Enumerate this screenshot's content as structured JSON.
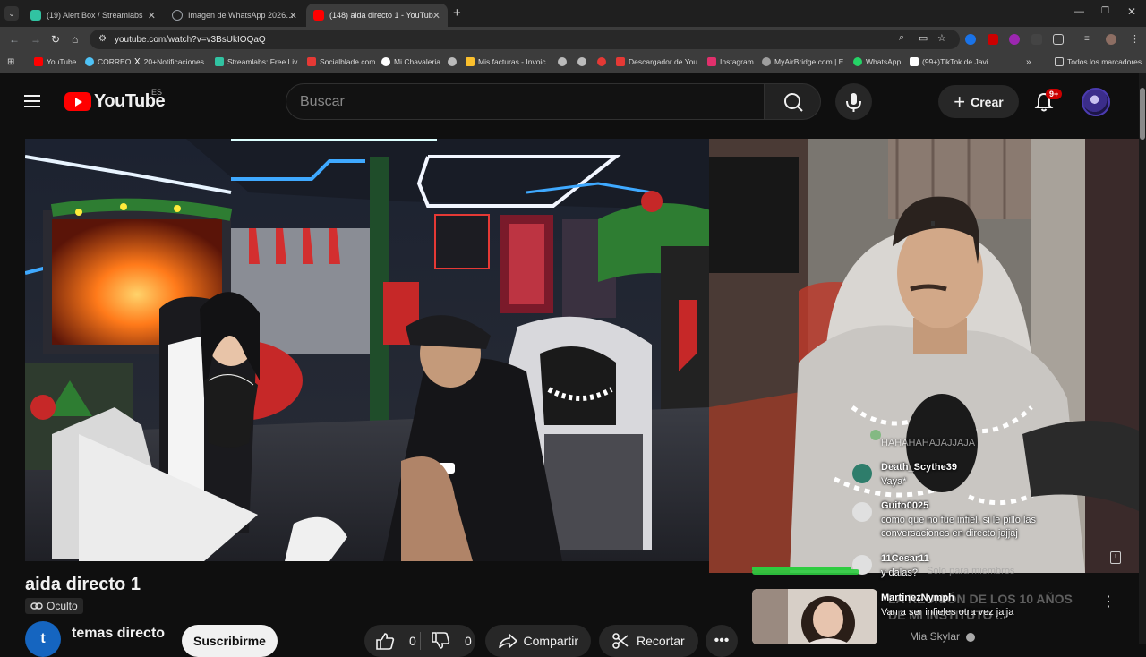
{
  "browser": {
    "tabs": [
      {
        "title": "(19) Alert Box / Streamlabs",
        "icon": "streamlabs-icon",
        "color": "#31c3a2"
      },
      {
        "title": "Imagen de WhatsApp 2026-01-",
        "icon": "globe-icon",
        "color": "#9aa0a6"
      },
      {
        "title": "(148) aida directo 1 - YouTub",
        "icon": "youtube-icon",
        "color": "#ff0000",
        "active": true
      }
    ],
    "url": "youtube.com/watch?v=v3BsUkIOQaQ",
    "bookmarks": [
      {
        "label": "YouTube",
        "color": "#ff0000"
      },
      {
        "label": "CORREO",
        "color": "#4fc3f7"
      },
      {
        "label": "20+Notificaciones",
        "color": "#ffffff"
      },
      {
        "label": "Streamlabs: Free Liv...",
        "color": "#31c3a2"
      },
      {
        "label": "Socialblade.com",
        "color": "#e53935"
      },
      {
        "label": "Mi Chavaleria",
        "color": "#ffffff"
      },
      {
        "label": "",
        "color": "#bbbbbb"
      },
      {
        "label": "Mis facturas - Invoic...",
        "color": "#fbc02d"
      },
      {
        "label": "",
        "color": "#bbbbbb"
      },
      {
        "label": "",
        "color": "#bbbbbb"
      },
      {
        "label": "",
        "color": "#e53935"
      },
      {
        "label": "Descargador de You...",
        "color": "#e53935"
      },
      {
        "label": "Instagram",
        "color": "#e1306c"
      },
      {
        "label": "MyAirBridge.com | E...",
        "color": "#9e9e9e"
      },
      {
        "label": "WhatsApp",
        "color": "#25d366"
      },
      {
        "label": "(99+)TikTok de Javi...",
        "color": "#ffffff"
      }
    ],
    "all_bookmarks": "Todos los marcadores"
  },
  "youtube": {
    "logo": "YouTube",
    "region": "ES",
    "search_placeholder": "Buscar",
    "create": "Crear",
    "notif_badge": "9+"
  },
  "chat": [
    {
      "name": "",
      "text": "HAHAHAHAJAJJAJA",
      "color": "#4caf50"
    },
    {
      "name": "Death_Scythe39",
      "text": "Vaya*",
      "color": "#2e7d6b"
    },
    {
      "name": "Guito0025",
      "text": "como que no fue infiel, si le pillo las conversaciones en directo jajjaj",
      "color": "#e0e0e0"
    },
    {
      "name": "11Cesar11",
      "text": "y dalas?",
      "color": "#e0e0e0"
    },
    {
      "name": "MartinezNymph",
      "text": "Van a ser infieles otra vez jajja",
      "color": "#8d6e63"
    }
  ],
  "video": {
    "title": "aida directo 1",
    "privacy": "Oculto",
    "channel": "temas directo",
    "channel_initial": "t",
    "subscribe": "Suscribirme",
    "likes": "0",
    "dislikes": "0",
    "share": "Compartir",
    "clip": "Recortar"
  },
  "sidebar": {
    "members_only": "Solo para miembros",
    "rec_title": "LA REUNIÓN DE LOS 10 AÑOS DE MI INSTITUTO ...",
    "rec_channel": "Mia Skylar"
  }
}
